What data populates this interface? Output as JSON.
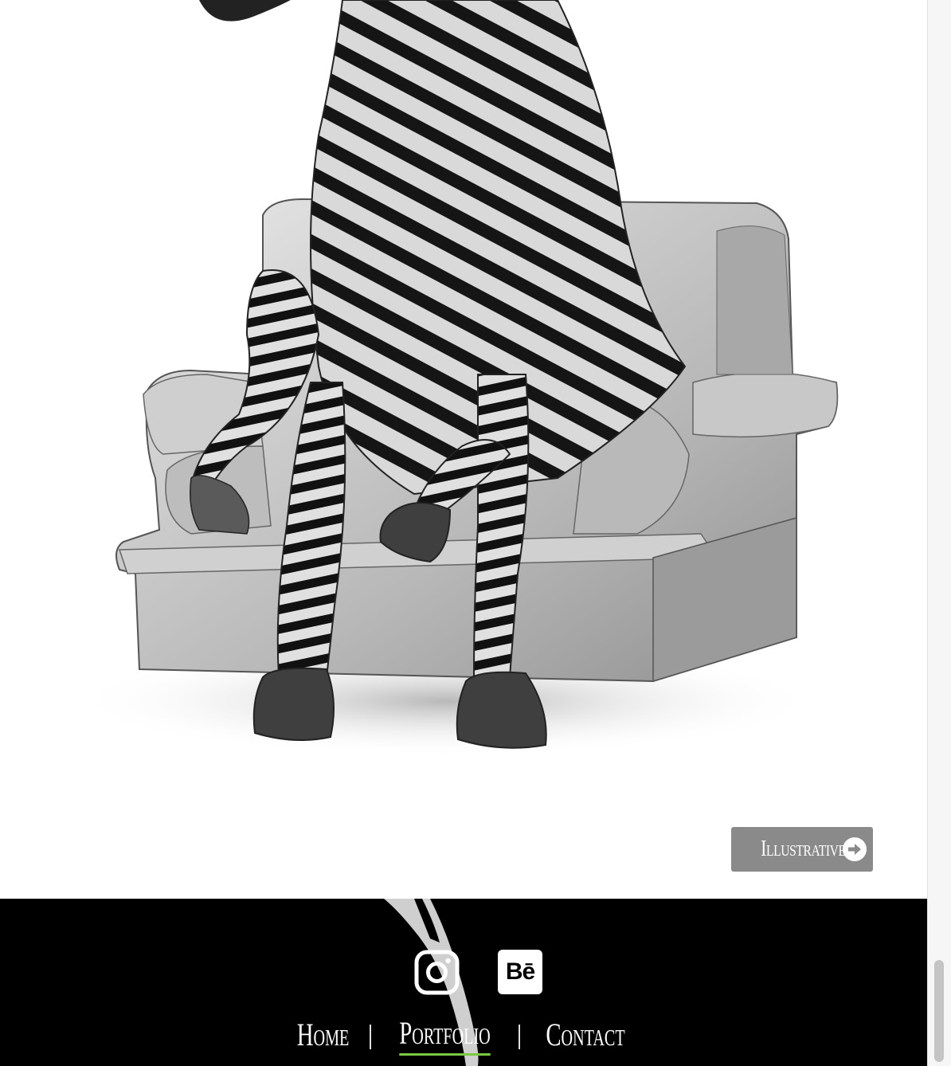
{
  "category_button": {
    "label": "Illustrative",
    "icon": "arrow-circle-right-icon"
  },
  "footer": {
    "social": [
      {
        "name": "Instagram",
        "icon": "instagram-icon"
      },
      {
        "name": "Behance",
        "icon": "behance-icon",
        "glyph": "Bē"
      }
    ],
    "nav": {
      "home": "Home",
      "portfolio": "Portfolio",
      "contact": "Contact",
      "separator": "|",
      "active": "Portfolio"
    }
  },
  "colors": {
    "button_bg": "#8a8a8a",
    "footer_bg": "#000000",
    "active_underline": "#7ac943"
  }
}
